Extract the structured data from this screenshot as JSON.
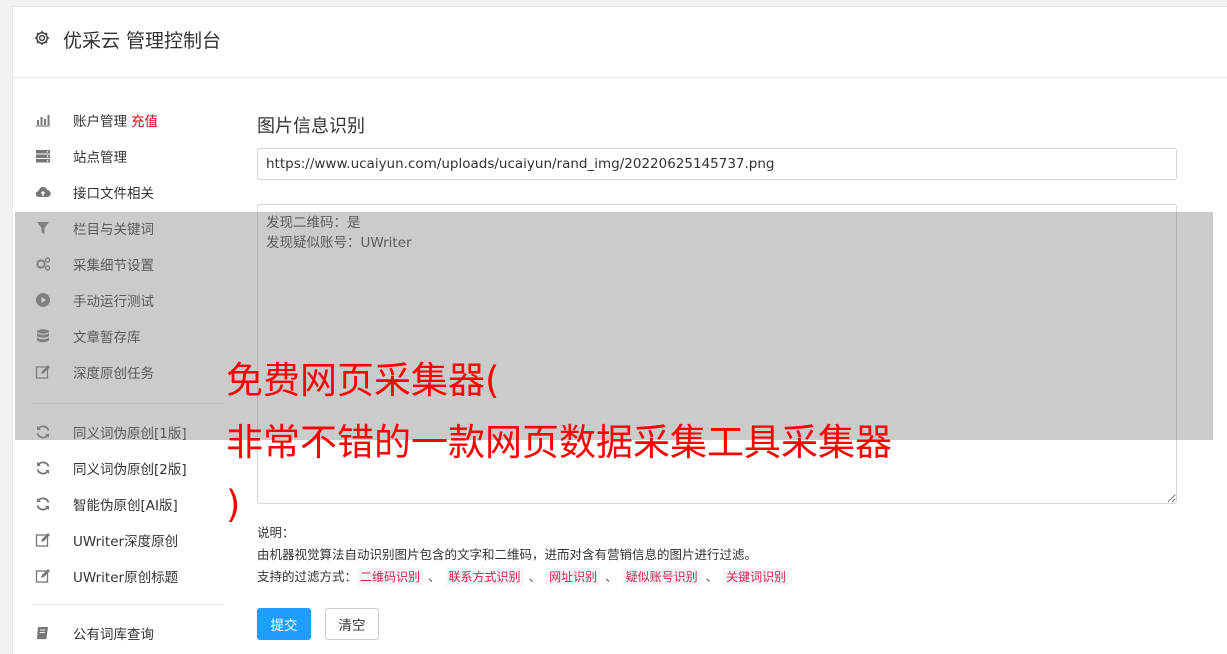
{
  "header": {
    "title": "优采云 管理控制台",
    "icon": "gear-icon"
  },
  "sidebar": {
    "items": [
      {
        "label": "账户管理",
        "badge": "充值",
        "icon": "bar-chart-icon"
      },
      {
        "label": "站点管理",
        "icon": "server-icon"
      },
      {
        "label": "接口文件相关",
        "icon": "cloud-upload-icon"
      },
      {
        "label": "栏目与关键词",
        "icon": "filter-icon"
      },
      {
        "label": "采集细节设置",
        "icon": "cogs-icon"
      },
      {
        "label": "手动运行测试",
        "icon": "play-circle-icon"
      },
      {
        "label": "文章暂存库",
        "icon": "database-icon"
      },
      {
        "label": "深度原创任务",
        "icon": "edit-icon"
      },
      {
        "label": "同义词伪原创[1版]",
        "icon": "refresh-icon"
      },
      {
        "label": "同义词伪原创[2版]",
        "icon": "refresh-icon"
      },
      {
        "label": "智能伪原创[AI版]",
        "icon": "refresh-icon"
      },
      {
        "label": "UWriter深度原创",
        "icon": "edit-icon"
      },
      {
        "label": "UWriter原创标题",
        "icon": "edit-icon"
      },
      {
        "label": "公有词库查询",
        "icon": "book-icon"
      }
    ]
  },
  "main": {
    "section_title": "图片信息识别",
    "url_value": "https://www.ucaiyun.com/uploads/ucaiyun/rand_img/20220625145737.png",
    "result_text": "发现二维码：是\n发现疑似账号：UWriter",
    "desc": {
      "label": "说明：",
      "line1": "由机器视觉算法自动识别图片包含的文字和二维码，进而对含有营销信息的图片进行过滤。",
      "line2_prefix": "支持的过滤方式：",
      "tags": [
        "二维码识别",
        "联系方式识别",
        "网址识别",
        "疑似账号识别",
        "关键词识别"
      ],
      "separator": "、"
    },
    "submit_label": "提交",
    "clear_label": "清空"
  },
  "overlay": {
    "text": "免费网页采集器(\n非常不错的一款网页数据采集工具采集器\n)"
  },
  "colors": {
    "accent": "#1e9fff",
    "recharge": "#d9001b",
    "overlay_text": "#ff0000"
  }
}
